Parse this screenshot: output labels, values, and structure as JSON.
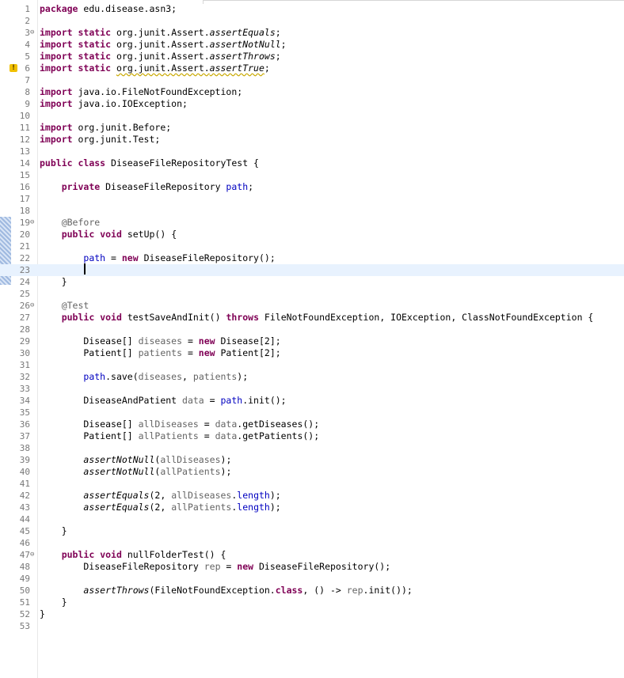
{
  "editor": {
    "current_line": 23,
    "warning_line": 6,
    "lines": [
      {
        "num": "1",
        "fold": "",
        "tokens": [
          {
            "c": "kw",
            "t": "package"
          },
          {
            "c": "plain",
            "t": " edu.disease.asn3;"
          }
        ]
      },
      {
        "num": "2",
        "fold": "",
        "tokens": []
      },
      {
        "num": "3",
        "fold": "⊖",
        "tokens": [
          {
            "c": "kw",
            "t": "import"
          },
          {
            "c": "plain",
            "t": " "
          },
          {
            "c": "kw",
            "t": "static"
          },
          {
            "c": "plain",
            "t": " org.junit.Assert."
          },
          {
            "c": "st",
            "t": "assertEquals"
          },
          {
            "c": "plain",
            "t": ";"
          }
        ]
      },
      {
        "num": "4",
        "fold": "",
        "tokens": [
          {
            "c": "kw",
            "t": "import"
          },
          {
            "c": "plain",
            "t": " "
          },
          {
            "c": "kw",
            "t": "static"
          },
          {
            "c": "plain",
            "t": " org.junit.Assert."
          },
          {
            "c": "st",
            "t": "assertNotNull"
          },
          {
            "c": "plain",
            "t": ";"
          }
        ]
      },
      {
        "num": "5",
        "fold": "",
        "tokens": [
          {
            "c": "kw",
            "t": "import"
          },
          {
            "c": "plain",
            "t": " "
          },
          {
            "c": "kw",
            "t": "static"
          },
          {
            "c": "plain",
            "t": " org.junit.Assert."
          },
          {
            "c": "st",
            "t": "assertThrows"
          },
          {
            "c": "plain",
            "t": ";"
          }
        ]
      },
      {
        "num": "6",
        "fold": "",
        "tokens": [
          {
            "c": "kw",
            "t": "import"
          },
          {
            "c": "plain",
            "t": " "
          },
          {
            "c": "kw",
            "t": "static"
          },
          {
            "c": "plain",
            "t": " "
          },
          {
            "c": "warn",
            "t": "org.junit.Assert."
          },
          {
            "c": "st warn",
            "t": "assertTrue"
          },
          {
            "c": "plain",
            "t": ";"
          }
        ]
      },
      {
        "num": "7",
        "fold": "",
        "tokens": []
      },
      {
        "num": "8",
        "fold": "",
        "tokens": [
          {
            "c": "kw",
            "t": "import"
          },
          {
            "c": "plain",
            "t": " java.io.FileNotFoundException;"
          }
        ]
      },
      {
        "num": "9",
        "fold": "",
        "tokens": [
          {
            "c": "kw",
            "t": "import"
          },
          {
            "c": "plain",
            "t": " java.io.IOException;"
          }
        ]
      },
      {
        "num": "10",
        "fold": "",
        "tokens": []
      },
      {
        "num": "11",
        "fold": "",
        "tokens": [
          {
            "c": "kw",
            "t": "import"
          },
          {
            "c": "plain",
            "t": " org.junit.Before;"
          }
        ]
      },
      {
        "num": "12",
        "fold": "",
        "tokens": [
          {
            "c": "kw",
            "t": "import"
          },
          {
            "c": "plain",
            "t": " org.junit.Test;"
          }
        ]
      },
      {
        "num": "13",
        "fold": "",
        "tokens": []
      },
      {
        "num": "14",
        "fold": "",
        "tokens": [
          {
            "c": "kw",
            "t": "public"
          },
          {
            "c": "plain",
            "t": " "
          },
          {
            "c": "kw",
            "t": "class"
          },
          {
            "c": "plain",
            "t": " DiseaseFileRepositoryTest {"
          }
        ]
      },
      {
        "num": "15",
        "fold": "",
        "tokens": []
      },
      {
        "num": "16",
        "fold": "",
        "tokens": [
          {
            "c": "plain",
            "t": "    "
          },
          {
            "c": "kw",
            "t": "private"
          },
          {
            "c": "plain",
            "t": " DiseaseFileRepository "
          },
          {
            "c": "fld",
            "t": "path"
          },
          {
            "c": "plain",
            "t": ";"
          }
        ]
      },
      {
        "num": "17",
        "fold": "",
        "tokens": []
      },
      {
        "num": "18",
        "fold": "",
        "tokens": []
      },
      {
        "num": "19",
        "fold": "⊖",
        "tokens": [
          {
            "c": "plain",
            "t": "    "
          },
          {
            "c": "ann",
            "t": "@Before"
          }
        ]
      },
      {
        "num": "20",
        "fold": "",
        "tokens": [
          {
            "c": "plain",
            "t": "    "
          },
          {
            "c": "kw",
            "t": "public"
          },
          {
            "c": "plain",
            "t": " "
          },
          {
            "c": "kw",
            "t": "void"
          },
          {
            "c": "plain",
            "t": " setUp() {"
          }
        ]
      },
      {
        "num": "21",
        "fold": "",
        "tokens": []
      },
      {
        "num": "22",
        "fold": "",
        "tokens": [
          {
            "c": "plain",
            "t": "        "
          },
          {
            "c": "fld",
            "t": "path"
          },
          {
            "c": "plain",
            "t": " = "
          },
          {
            "c": "kw",
            "t": "new"
          },
          {
            "c": "plain",
            "t": " DiseaseFileRepository();"
          }
        ]
      },
      {
        "num": "23",
        "fold": "",
        "tokens": []
      },
      {
        "num": "24",
        "fold": "",
        "tokens": [
          {
            "c": "plain",
            "t": "    }"
          }
        ]
      },
      {
        "num": "25",
        "fold": "",
        "tokens": []
      },
      {
        "num": "26",
        "fold": "⊖",
        "tokens": [
          {
            "c": "plain",
            "t": "    "
          },
          {
            "c": "ann",
            "t": "@Test"
          }
        ]
      },
      {
        "num": "27",
        "fold": "",
        "tokens": [
          {
            "c": "plain",
            "t": "    "
          },
          {
            "c": "kw",
            "t": "public"
          },
          {
            "c": "plain",
            "t": " "
          },
          {
            "c": "kw",
            "t": "void"
          },
          {
            "c": "plain",
            "t": " testSaveAndInit() "
          },
          {
            "c": "kw",
            "t": "throws"
          },
          {
            "c": "plain",
            "t": " FileNotFoundException, IOException, ClassNotFoundException {"
          }
        ]
      },
      {
        "num": "28",
        "fold": "",
        "tokens": []
      },
      {
        "num": "29",
        "fold": "",
        "tokens": [
          {
            "c": "plain",
            "t": "        Disease[] "
          },
          {
            "c": "ann",
            "t": "diseases"
          },
          {
            "c": "plain",
            "t": " = "
          },
          {
            "c": "kw",
            "t": "new"
          },
          {
            "c": "plain",
            "t": " Disease[2];"
          }
        ]
      },
      {
        "num": "30",
        "fold": "",
        "tokens": [
          {
            "c": "plain",
            "t": "        Patient[] "
          },
          {
            "c": "ann",
            "t": "patients"
          },
          {
            "c": "plain",
            "t": " = "
          },
          {
            "c": "kw",
            "t": "new"
          },
          {
            "c": "plain",
            "t": " Patient[2];"
          }
        ]
      },
      {
        "num": "31",
        "fold": "",
        "tokens": []
      },
      {
        "num": "32",
        "fold": "",
        "tokens": [
          {
            "c": "plain",
            "t": "        "
          },
          {
            "c": "fld",
            "t": "path"
          },
          {
            "c": "plain",
            "t": ".save("
          },
          {
            "c": "ann",
            "t": "diseases"
          },
          {
            "c": "plain",
            "t": ", "
          },
          {
            "c": "ann",
            "t": "patients"
          },
          {
            "c": "plain",
            "t": ");"
          }
        ]
      },
      {
        "num": "33",
        "fold": "",
        "tokens": []
      },
      {
        "num": "34",
        "fold": "",
        "tokens": [
          {
            "c": "plain",
            "t": "        DiseaseAndPatient "
          },
          {
            "c": "ann",
            "t": "data"
          },
          {
            "c": "plain",
            "t": " = "
          },
          {
            "c": "fld",
            "t": "path"
          },
          {
            "c": "plain",
            "t": ".init();"
          }
        ]
      },
      {
        "num": "35",
        "fold": "",
        "tokens": []
      },
      {
        "num": "36",
        "fold": "",
        "tokens": [
          {
            "c": "plain",
            "t": "        Disease[] "
          },
          {
            "c": "ann",
            "t": "allDiseases"
          },
          {
            "c": "plain",
            "t": " = "
          },
          {
            "c": "ann",
            "t": "data"
          },
          {
            "c": "plain",
            "t": ".getDiseases();"
          }
        ]
      },
      {
        "num": "37",
        "fold": "",
        "tokens": [
          {
            "c": "plain",
            "t": "        Patient[] "
          },
          {
            "c": "ann",
            "t": "allPatients"
          },
          {
            "c": "plain",
            "t": " = "
          },
          {
            "c": "ann",
            "t": "data"
          },
          {
            "c": "plain",
            "t": ".getPatients();"
          }
        ]
      },
      {
        "num": "38",
        "fold": "",
        "tokens": []
      },
      {
        "num": "39",
        "fold": "",
        "tokens": [
          {
            "c": "plain",
            "t": "        "
          },
          {
            "c": "st",
            "t": "assertNotNull"
          },
          {
            "c": "plain",
            "t": "("
          },
          {
            "c": "ann",
            "t": "allDiseases"
          },
          {
            "c": "plain",
            "t": ");"
          }
        ]
      },
      {
        "num": "40",
        "fold": "",
        "tokens": [
          {
            "c": "plain",
            "t": "        "
          },
          {
            "c": "st",
            "t": "assertNotNull"
          },
          {
            "c": "plain",
            "t": "("
          },
          {
            "c": "ann",
            "t": "allPatients"
          },
          {
            "c": "plain",
            "t": ");"
          }
        ]
      },
      {
        "num": "41",
        "fold": "",
        "tokens": []
      },
      {
        "num": "42",
        "fold": "",
        "tokens": [
          {
            "c": "plain",
            "t": "        "
          },
          {
            "c": "st",
            "t": "assertEquals"
          },
          {
            "c": "plain",
            "t": "(2, "
          },
          {
            "c": "ann",
            "t": "allDiseases"
          },
          {
            "c": "plain",
            "t": "."
          },
          {
            "c": "fld",
            "t": "length"
          },
          {
            "c": "plain",
            "t": ");"
          }
        ]
      },
      {
        "num": "43",
        "fold": "",
        "tokens": [
          {
            "c": "plain",
            "t": "        "
          },
          {
            "c": "st",
            "t": "assertEquals"
          },
          {
            "c": "plain",
            "t": "(2, "
          },
          {
            "c": "ann",
            "t": "allPatients"
          },
          {
            "c": "plain",
            "t": "."
          },
          {
            "c": "fld",
            "t": "length"
          },
          {
            "c": "plain",
            "t": ");"
          }
        ]
      },
      {
        "num": "44",
        "fold": "",
        "tokens": []
      },
      {
        "num": "45",
        "fold": "",
        "tokens": [
          {
            "c": "plain",
            "t": "    }"
          }
        ]
      },
      {
        "num": "46",
        "fold": "",
        "tokens": []
      },
      {
        "num": "47",
        "fold": "⊖",
        "tokens": [
          {
            "c": "plain",
            "t": "    "
          },
          {
            "c": "kw",
            "t": "public"
          },
          {
            "c": "plain",
            "t": " "
          },
          {
            "c": "kw",
            "t": "void"
          },
          {
            "c": "plain",
            "t": " nullFolderTest() {"
          }
        ]
      },
      {
        "num": "48",
        "fold": "",
        "tokens": [
          {
            "c": "plain",
            "t": "        DiseaseFileRepository "
          },
          {
            "c": "ann",
            "t": "rep"
          },
          {
            "c": "plain",
            "t": " = "
          },
          {
            "c": "kw",
            "t": "new"
          },
          {
            "c": "plain",
            "t": " DiseaseFileRepository();"
          }
        ]
      },
      {
        "num": "49",
        "fold": "",
        "tokens": []
      },
      {
        "num": "50",
        "fold": "",
        "tokens": [
          {
            "c": "plain",
            "t": "        "
          },
          {
            "c": "st",
            "t": "assertThrows"
          },
          {
            "c": "plain",
            "t": "(FileNotFoundException."
          },
          {
            "c": "kw",
            "t": "class"
          },
          {
            "c": "plain",
            "t": ", () -> "
          },
          {
            "c": "ann",
            "t": "rep"
          },
          {
            "c": "plain",
            "t": ".init());"
          }
        ]
      },
      {
        "num": "51",
        "fold": "",
        "tokens": [
          {
            "c": "plain",
            "t": "    }"
          }
        ]
      },
      {
        "num": "52",
        "fold": "",
        "tokens": [
          {
            "c": "plain",
            "t": "}"
          }
        ]
      },
      {
        "num": "53",
        "fold": "",
        "tokens": []
      }
    ]
  }
}
